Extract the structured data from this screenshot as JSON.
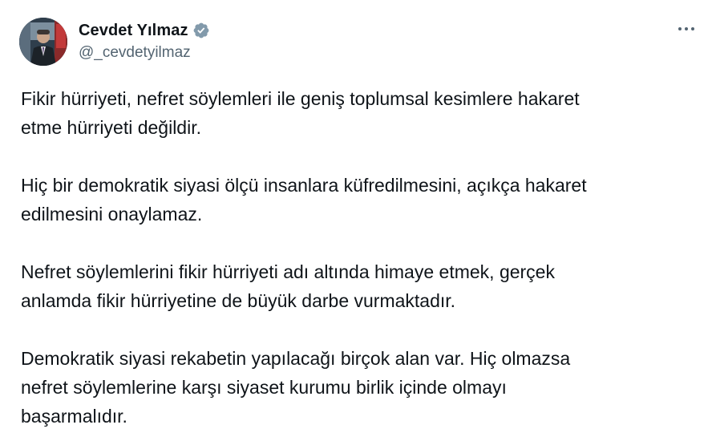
{
  "author": {
    "display_name": "Cevdet Yılmaz",
    "handle": "@_cevdetyilmaz",
    "verified": true,
    "verified_badge_color": "#829aab"
  },
  "menu": {
    "icon": "more-horizontal-icon"
  },
  "tweet": {
    "paragraphs": [
      {
        "lines": [
          "Fikir hürriyeti, nefret söylemleri ile geniş toplumsal kesimlere hakaret",
          "etme hürriyeti değildir."
        ]
      },
      {
        "lines": [
          "Hiç bir demokratik siyasi ölçü insanlara küfredilmesini, açıkça hakaret",
          "edilmesini onaylamaz."
        ]
      },
      {
        "lines": [
          "Nefret söylemlerini fikir hürriyeti adı altında himaye etmek, gerçek",
          "anlamda fikir hürriyetine de büyük darbe vurmaktadır."
        ]
      },
      {
        "lines": [
          "Demokratik siyasi rekabetin yapılacağı birçok alan var. Hiç olmazsa",
          "nefret söylemlerine karşı siyaset kurumu birlik içinde olmayı",
          "başarmalıdır."
        ]
      }
    ]
  }
}
